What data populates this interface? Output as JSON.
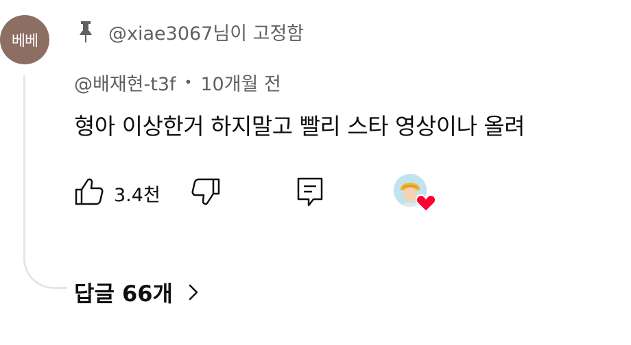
{
  "comment": {
    "avatar_text": "베베",
    "pinned_text": "@xiae3067님이 고정함",
    "author": "@배재현-t3f",
    "separator": "•",
    "timestamp": "10개월 전",
    "text": "형아 이상한거 하지말고 빨리 스타 영상이나 올려",
    "like_count": "3.4천",
    "replies_label": "답글 66개"
  },
  "colors": {
    "avatar_bg": "#8d6e63",
    "heart": "#ff0033",
    "meta_text": "#606060",
    "thread_line": "#e5e5e5"
  },
  "icons": {
    "pin": "pin-icon",
    "like": "thumb-up-icon",
    "dislike": "thumb-down-icon",
    "reply": "reply-comment-icon",
    "heart": "heart-icon",
    "chevron": "chevron-right-icon"
  }
}
